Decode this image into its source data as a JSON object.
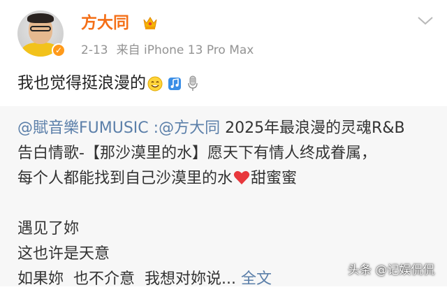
{
  "post": {
    "author": {
      "name": "方大同",
      "verified": true,
      "accent_color": "#f46f17"
    },
    "meta": {
      "date": "2-13",
      "source": "来自 iPhone 13 Pro Max"
    },
    "text": "我也觉得挺浪漫的",
    "inline_icons": [
      "smile-emoji-icon",
      "music-note-icon",
      "microphone-icon"
    ]
  },
  "repost": {
    "mention_source": "@賦音樂FUMUSIC",
    "separator": " :",
    "mention_author": "@方大同",
    "line1_rest": " 2025年最浪漫的灵魂R&B",
    "line2": "告白情歌-【那沙漠里的水】愿天下有情人终成眷属，",
    "line3_a": "每个人都能找到自己沙漠里的水",
    "line3_b": "甜蜜蜜",
    "line4": "遇见了妳",
    "line5": "这也许是天意",
    "line6": "如果妳  也不介意  我想对妳说... ",
    "more_label": "全文",
    "link_color": "#5b7fa9"
  },
  "watermark": "头条 @记娱侃侃"
}
